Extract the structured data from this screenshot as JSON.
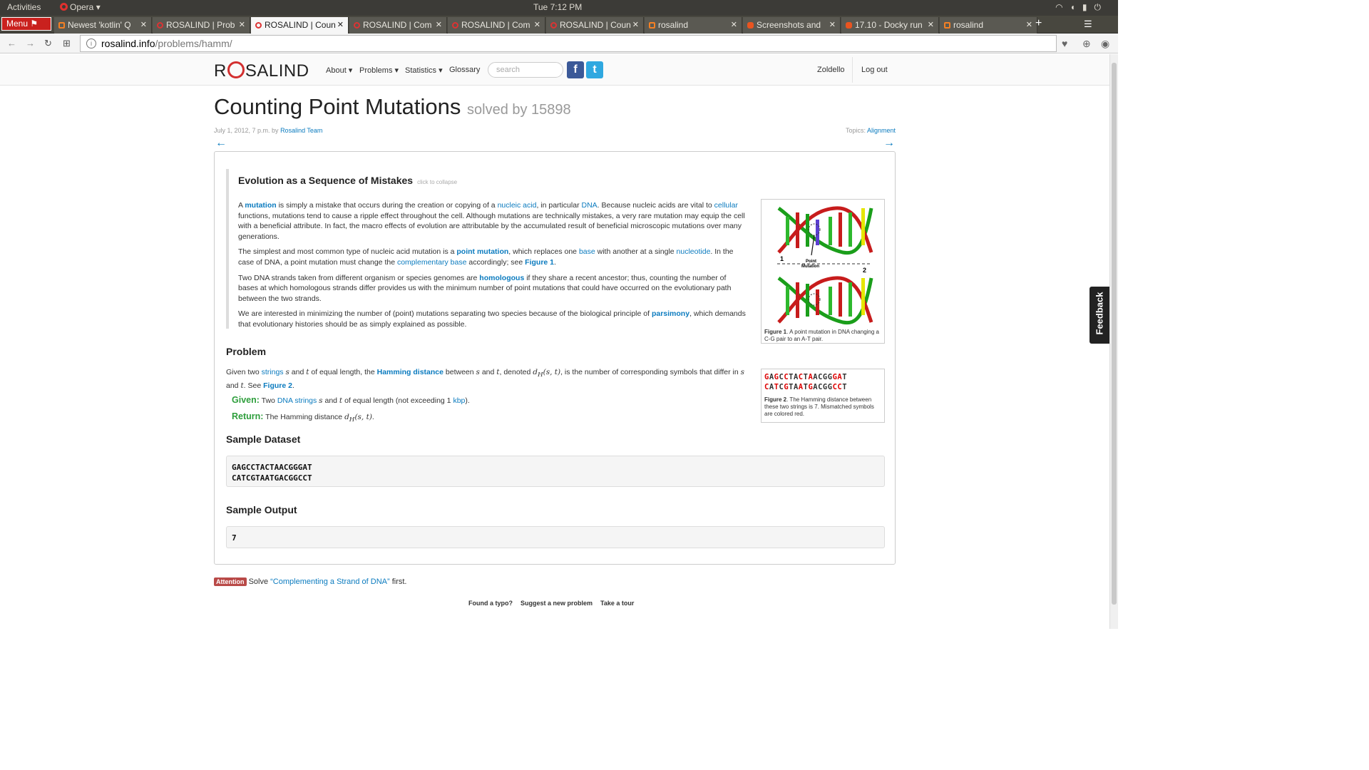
{
  "os": {
    "activities": "Activities",
    "browser": "Opera",
    "clock": "Tue  7:12 PM"
  },
  "browser": {
    "menu_label": "Menu",
    "tabs": [
      {
        "label": "Newest 'kotlin' Q",
        "icon": "stackoverflow-icon"
      },
      {
        "label": "ROSALIND | Prob",
        "icon": "rosalind-icon"
      },
      {
        "label": "ROSALIND | Coun",
        "icon": "rosalind-icon"
      },
      {
        "label": "ROSALIND | Com",
        "icon": "rosalind-icon"
      },
      {
        "label": "ROSALIND | Com",
        "icon": "rosalind-icon"
      },
      {
        "label": "ROSALIND | Coun",
        "icon": "rosalind-icon"
      },
      {
        "label": "rosalind",
        "icon": "search-icon"
      },
      {
        "label": "Screenshots and",
        "icon": "ubuntu-icon"
      },
      {
        "label": "17.10 - Docky run",
        "icon": "askubuntu-icon"
      },
      {
        "label": "rosalind",
        "icon": "search-icon"
      }
    ],
    "url_host": "rosalind.info",
    "url_path": "/problems/hamm/"
  },
  "site": {
    "logo_pre": "R",
    "logo_post": "SALIND",
    "nav": {
      "about": "About ▾",
      "problems": "Problems ▾",
      "statistics": "Statistics ▾",
      "glossary": "Glossary"
    },
    "search_placeholder": "search",
    "username": "Zoldello",
    "logout": "Log out"
  },
  "problem": {
    "title": "Counting Point Mutations",
    "solved_by": "solved by 15898",
    "date": "July 1, 2012, 7 p.m. by ",
    "author": "Rosalind Team",
    "topics_label": "Topics: ",
    "topics": "Alignment",
    "prev_arrow": "←",
    "next_arrow": "→",
    "story_title": "Evolution as a Sequence of Mistakes",
    "collapse": "click to collapse",
    "fig1_caption_bold": "Figure 1",
    "fig1_caption": ". A point mutation in DNA changing a C-G pair to an A-T pair.",
    "fig1_label1": "1",
    "fig1_label2": "2",
    "fig1_point": "Point",
    "fig1_mutation": "Mutation",
    "fig2_caption_bold": "Figure 2",
    "fig2_caption": ". The Hamming distance between these two strings is 7. Mismatched symbols are colored red.",
    "problem_heading": "Problem",
    "given_label": "Given:",
    "return_label": "Return:",
    "sample_dataset_heading": "Sample Dataset",
    "sample_dataset_line1": "GAGCCTACTAACGGGAT",
    "sample_dataset_line2": "CATCGTAATGACGGCCT",
    "sample_output_heading": "Sample Output",
    "sample_output": "7"
  },
  "attention": {
    "badge": "Attention",
    "pre": "Solve ",
    "link": "“Complementing a Strand of DNA”",
    "post": " first."
  },
  "footer": {
    "typo": "Found a typo?",
    "suggest": "Suggest a new problem",
    "tour": "Take a tour"
  },
  "feedback": "Feedback",
  "colors": {
    "link": "#0b7bbf",
    "given": "#2e9e3c",
    "mismatch": "#dd0000",
    "opera_red": "#c9211e"
  }
}
